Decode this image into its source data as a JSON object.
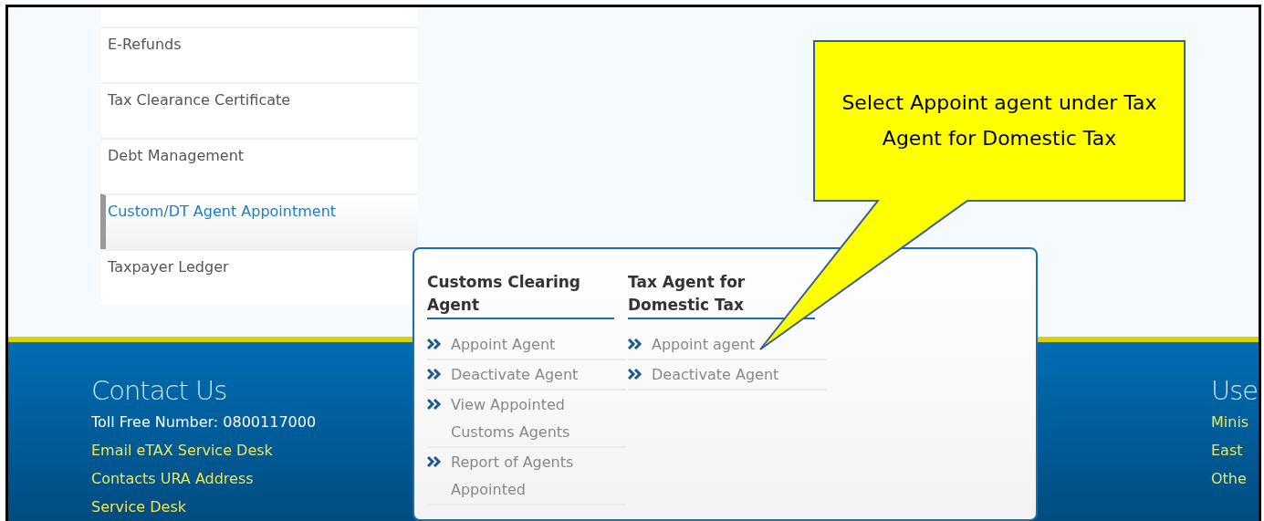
{
  "sidebar": {
    "items": [
      {
        "label": "E-Refunds",
        "selected": false
      },
      {
        "label": "Tax Clearance Certificate",
        "selected": false
      },
      {
        "label": "Debt Management",
        "selected": false
      },
      {
        "label": "Custom/DT Agent Appointment",
        "selected": true
      },
      {
        "label": "Taxpayer Ledger",
        "selected": false
      }
    ]
  },
  "mega_menu": {
    "columns": [
      {
        "heading": "Customs Clearing Agent",
        "items": [
          "Appoint Agent",
          "Deactivate Agent",
          "View Appointed Customs Agents",
          "Report of Agents Appointed"
        ]
      },
      {
        "heading": "Tax Agent for Domestic Tax",
        "items": [
          "Appoint agent",
          "Deactivate Agent"
        ]
      }
    ]
  },
  "footer": {
    "contact": {
      "heading": "Contact Us",
      "phone": "Toll Free Number: 0800117000",
      "links": [
        "Email eTAX Service Desk",
        "Contacts URA Address",
        "Service Desk"
      ]
    },
    "useful": {
      "heading": "Use",
      "links": [
        "Minis",
        "East",
        "Othe"
      ]
    }
  },
  "callout": {
    "text": "Select Appoint agent under Tax Agent for Domestic Tax"
  }
}
